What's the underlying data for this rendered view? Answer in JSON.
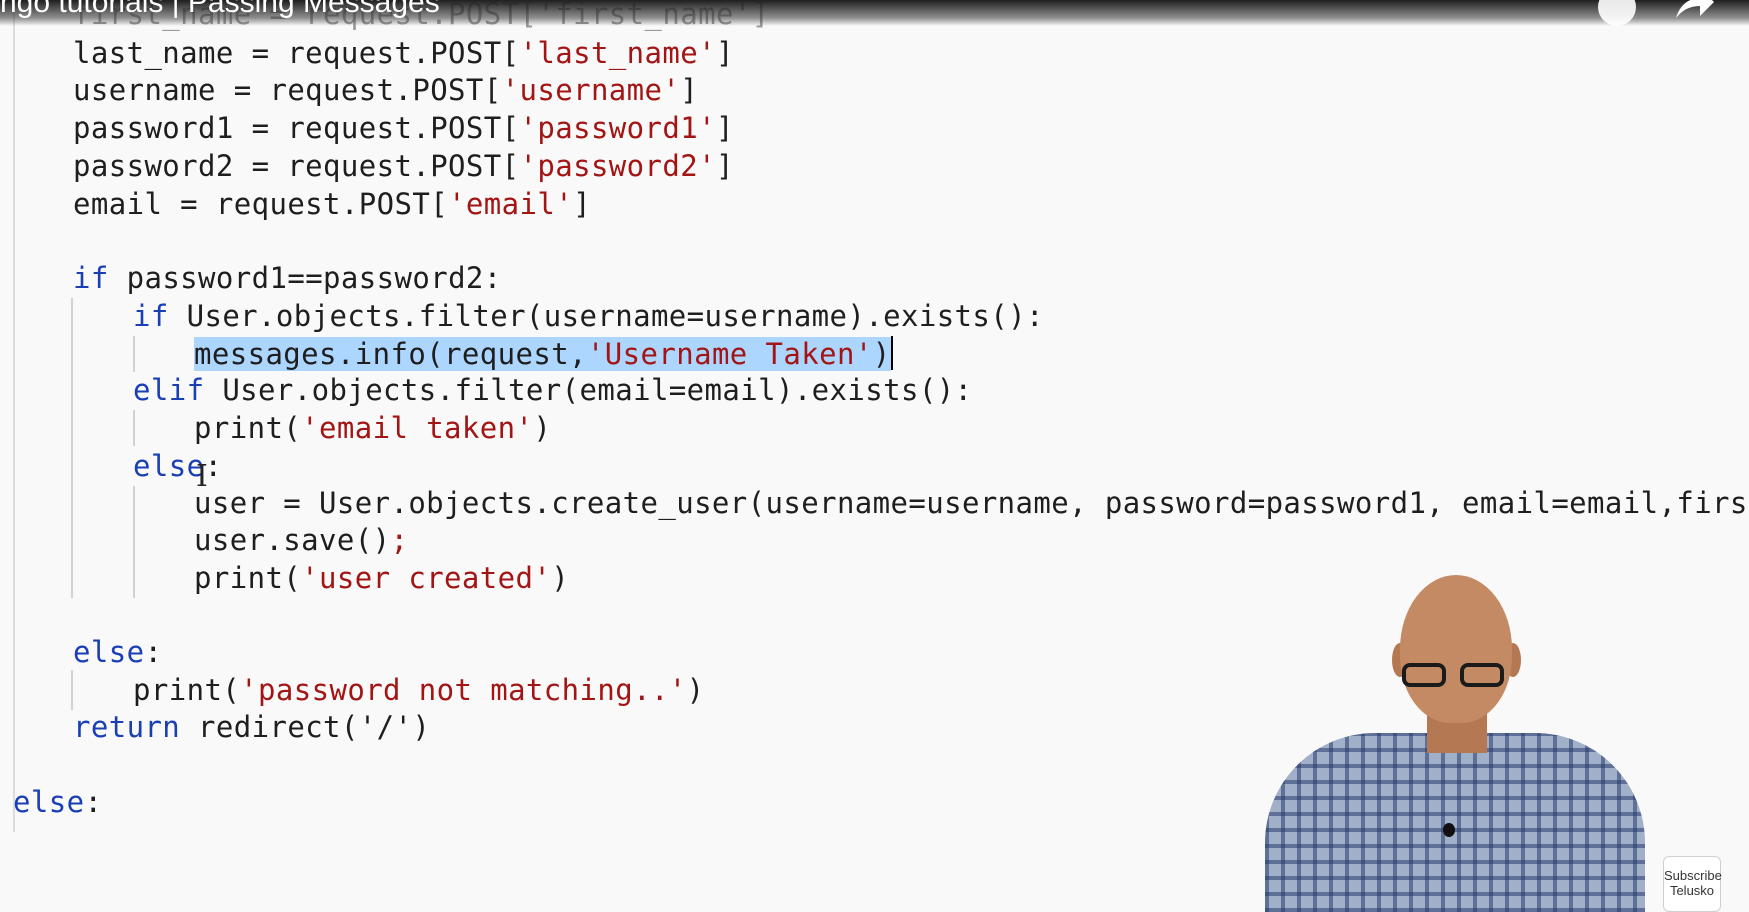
{
  "video": {
    "title": "ngo tutorials | Passing Messages"
  },
  "code": {
    "line_top_cut": "first_name = request.POST['first_name']",
    "l1_a": "last_name = request.POST[",
    "l1_s": "'last_name'",
    "l1_b": "]",
    "l2_a": "username = request.POST[",
    "l2_s": "'username'",
    "l2_b": "]",
    "l3_a": "password1 = request.POST[",
    "l3_s": "'password1'",
    "l3_b": "]",
    "l4_a": "password2 = request.POST[",
    "l4_s": "'password2'",
    "l4_b": "]",
    "l5_a": "email = request.POST[",
    "l5_s": "'email'",
    "l5_b": "]",
    "l6_kw": "if",
    "l6_rest": " password1==password2:",
    "l7_kw": "if",
    "l7_rest": " User.objects.filter(username=username).exists():",
    "l8_a": "messages.info(request,",
    "l8_s": "'Username Taken'",
    "l8_b": ")",
    "l9_kw": "elif",
    "l9_rest": " User.objects.filter(email=email).exists():",
    "l10_a": "print(",
    "l10_s": "'email taken'",
    "l10_b": ")",
    "l11_kw": "else",
    "l11_rest": ":",
    "l12": "user = User.objects.create_user(username=username, password=password1, email=email,first_na",
    "l13_a": "user.save()",
    "l13_s": ";",
    "l14_a": "print(",
    "l14_s": "'user created'",
    "l14_b": ")",
    "l15_kw": "else",
    "l15_rest": ":",
    "l16_a": "print(",
    "l16_s": "'password not matching..'",
    "l16_b": ")",
    "l17_kw": "return",
    "l17_rest": " redirect('/')",
    "l18_kw": "else",
    "l18_rest": ":"
  },
  "subscribe": {
    "line1": "Subscribe",
    "line2": "Telusko"
  },
  "colors": {
    "keyword": "#1a3fb5",
    "string": "#a31515",
    "selection": "#add6ff"
  },
  "icons": [
    "circle-button-icon",
    "share-arrow-icon",
    "text-cursor-icon"
  ]
}
